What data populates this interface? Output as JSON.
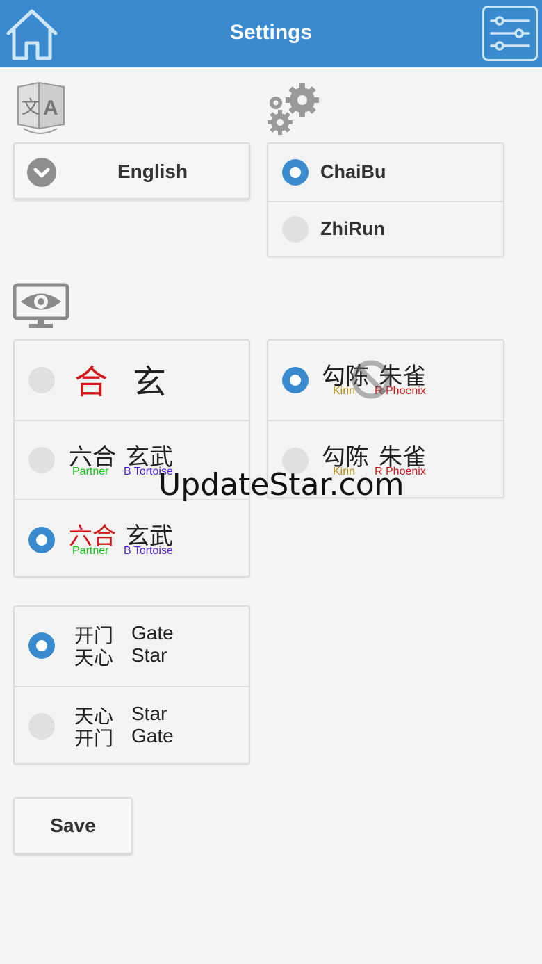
{
  "header": {
    "title": "Settings",
    "home_icon": "home-icon",
    "menu_icon": "sliders-icon"
  },
  "language": {
    "icon": "translate-icon",
    "selected": "English"
  },
  "method": {
    "icon": "gears-icon",
    "options": [
      {
        "label": "ChaiBu",
        "selected": true
      },
      {
        "label": "ZhiRun",
        "selected": false
      }
    ]
  },
  "display": {
    "icon": "eye-monitor-icon",
    "palace_names": [
      {
        "cn_a": "合",
        "cn_b": "玄",
        "selected": false
      },
      {
        "cn_a": "六合",
        "cn_b": "玄武",
        "en_a": "Partner",
        "en_b": "B Tortoise",
        "selected": false
      },
      {
        "cn_a": "六合",
        "cn_b": "玄武",
        "en_a": "Partner",
        "en_b": "B Tortoise",
        "selected": true
      }
    ],
    "beast_names": [
      {
        "cn_a": "勾陈",
        "cn_b": "朱雀",
        "en_a": "Kirin",
        "en_b": "R Phoenix",
        "selected": true
      },
      {
        "cn_a": "勾陈",
        "cn_b": "朱雀",
        "en_a": "Kirin",
        "en_b": "R Phoenix",
        "selected": false
      }
    ],
    "order": [
      {
        "cn_1": "开门",
        "en_1": "Gate",
        "cn_2": "天心",
        "en_2": "Star",
        "selected": true
      },
      {
        "cn_1": "天心",
        "en_1": "Star",
        "cn_2": "开门",
        "en_2": "Gate",
        "selected": false
      }
    ]
  },
  "save_label": "Save",
  "watermark": "UpdateStar.com",
  "colors": {
    "header": "#3a8ad0",
    "radio_on": "#3a8ad0",
    "red": "#d21818",
    "green": "#19c219",
    "purple": "#4a1fd6",
    "gold": "#b08a10"
  }
}
